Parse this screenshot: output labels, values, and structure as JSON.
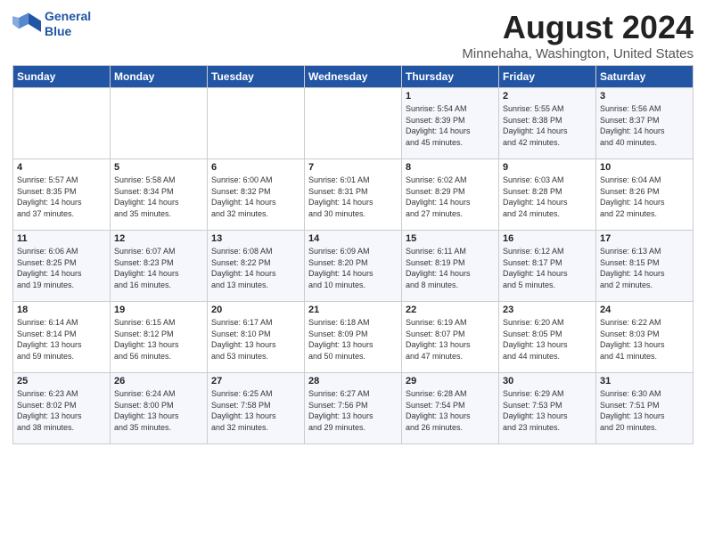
{
  "header": {
    "logo_line1": "General",
    "logo_line2": "Blue",
    "month_year": "August 2024",
    "location": "Minnehaha, Washington, United States"
  },
  "days_of_week": [
    "Sunday",
    "Monday",
    "Tuesday",
    "Wednesday",
    "Thursday",
    "Friday",
    "Saturday"
  ],
  "weeks": [
    [
      {
        "day": "",
        "info": ""
      },
      {
        "day": "",
        "info": ""
      },
      {
        "day": "",
        "info": ""
      },
      {
        "day": "",
        "info": ""
      },
      {
        "day": "1",
        "info": "Sunrise: 5:54 AM\nSunset: 8:39 PM\nDaylight: 14 hours\nand 45 minutes."
      },
      {
        "day": "2",
        "info": "Sunrise: 5:55 AM\nSunset: 8:38 PM\nDaylight: 14 hours\nand 42 minutes."
      },
      {
        "day": "3",
        "info": "Sunrise: 5:56 AM\nSunset: 8:37 PM\nDaylight: 14 hours\nand 40 minutes."
      }
    ],
    [
      {
        "day": "4",
        "info": "Sunrise: 5:57 AM\nSunset: 8:35 PM\nDaylight: 14 hours\nand 37 minutes."
      },
      {
        "day": "5",
        "info": "Sunrise: 5:58 AM\nSunset: 8:34 PM\nDaylight: 14 hours\nand 35 minutes."
      },
      {
        "day": "6",
        "info": "Sunrise: 6:00 AM\nSunset: 8:32 PM\nDaylight: 14 hours\nand 32 minutes."
      },
      {
        "day": "7",
        "info": "Sunrise: 6:01 AM\nSunset: 8:31 PM\nDaylight: 14 hours\nand 30 minutes."
      },
      {
        "day": "8",
        "info": "Sunrise: 6:02 AM\nSunset: 8:29 PM\nDaylight: 14 hours\nand 27 minutes."
      },
      {
        "day": "9",
        "info": "Sunrise: 6:03 AM\nSunset: 8:28 PM\nDaylight: 14 hours\nand 24 minutes."
      },
      {
        "day": "10",
        "info": "Sunrise: 6:04 AM\nSunset: 8:26 PM\nDaylight: 14 hours\nand 22 minutes."
      }
    ],
    [
      {
        "day": "11",
        "info": "Sunrise: 6:06 AM\nSunset: 8:25 PM\nDaylight: 14 hours\nand 19 minutes."
      },
      {
        "day": "12",
        "info": "Sunrise: 6:07 AM\nSunset: 8:23 PM\nDaylight: 14 hours\nand 16 minutes."
      },
      {
        "day": "13",
        "info": "Sunrise: 6:08 AM\nSunset: 8:22 PM\nDaylight: 14 hours\nand 13 minutes."
      },
      {
        "day": "14",
        "info": "Sunrise: 6:09 AM\nSunset: 8:20 PM\nDaylight: 14 hours\nand 10 minutes."
      },
      {
        "day": "15",
        "info": "Sunrise: 6:11 AM\nSunset: 8:19 PM\nDaylight: 14 hours\nand 8 minutes."
      },
      {
        "day": "16",
        "info": "Sunrise: 6:12 AM\nSunset: 8:17 PM\nDaylight: 14 hours\nand 5 minutes."
      },
      {
        "day": "17",
        "info": "Sunrise: 6:13 AM\nSunset: 8:15 PM\nDaylight: 14 hours\nand 2 minutes."
      }
    ],
    [
      {
        "day": "18",
        "info": "Sunrise: 6:14 AM\nSunset: 8:14 PM\nDaylight: 13 hours\nand 59 minutes."
      },
      {
        "day": "19",
        "info": "Sunrise: 6:15 AM\nSunset: 8:12 PM\nDaylight: 13 hours\nand 56 minutes."
      },
      {
        "day": "20",
        "info": "Sunrise: 6:17 AM\nSunset: 8:10 PM\nDaylight: 13 hours\nand 53 minutes."
      },
      {
        "day": "21",
        "info": "Sunrise: 6:18 AM\nSunset: 8:09 PM\nDaylight: 13 hours\nand 50 minutes."
      },
      {
        "day": "22",
        "info": "Sunrise: 6:19 AM\nSunset: 8:07 PM\nDaylight: 13 hours\nand 47 minutes."
      },
      {
        "day": "23",
        "info": "Sunrise: 6:20 AM\nSunset: 8:05 PM\nDaylight: 13 hours\nand 44 minutes."
      },
      {
        "day": "24",
        "info": "Sunrise: 6:22 AM\nSunset: 8:03 PM\nDaylight: 13 hours\nand 41 minutes."
      }
    ],
    [
      {
        "day": "25",
        "info": "Sunrise: 6:23 AM\nSunset: 8:02 PM\nDaylight: 13 hours\nand 38 minutes."
      },
      {
        "day": "26",
        "info": "Sunrise: 6:24 AM\nSunset: 8:00 PM\nDaylight: 13 hours\nand 35 minutes."
      },
      {
        "day": "27",
        "info": "Sunrise: 6:25 AM\nSunset: 7:58 PM\nDaylight: 13 hours\nand 32 minutes."
      },
      {
        "day": "28",
        "info": "Sunrise: 6:27 AM\nSunset: 7:56 PM\nDaylight: 13 hours\nand 29 minutes."
      },
      {
        "day": "29",
        "info": "Sunrise: 6:28 AM\nSunset: 7:54 PM\nDaylight: 13 hours\nand 26 minutes."
      },
      {
        "day": "30",
        "info": "Sunrise: 6:29 AM\nSunset: 7:53 PM\nDaylight: 13 hours\nand 23 minutes."
      },
      {
        "day": "31",
        "info": "Sunrise: 6:30 AM\nSunset: 7:51 PM\nDaylight: 13 hours\nand 20 minutes."
      }
    ]
  ]
}
